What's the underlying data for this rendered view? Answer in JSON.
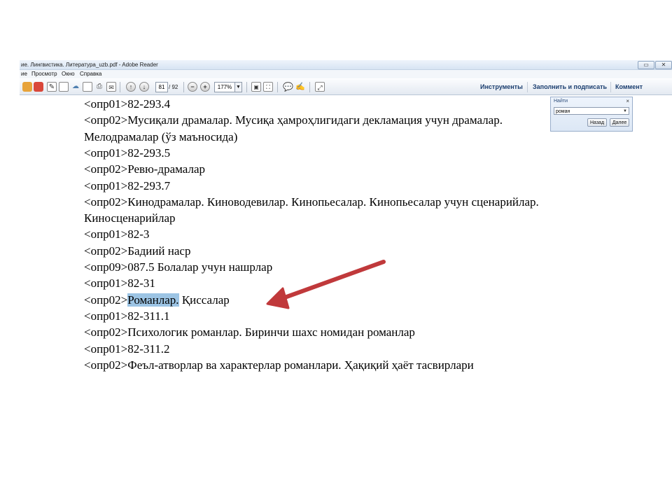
{
  "window": {
    "title": "ие. Лингвистика. Литература_uzb.pdf - Adobe Reader",
    "buttons": [
      "▭",
      "✕"
    ]
  },
  "menu": [
    "ие",
    "Просмотр",
    "Окно",
    "Справка"
  ],
  "toolbar": {
    "page_current": "81",
    "page_total": "/ 92",
    "zoom": "177%",
    "zoom_dropdown": "▼",
    "tools": "Инструменты",
    "fill_sign": "Заполнить и подписать",
    "comment": "Коммент"
  },
  "find": {
    "title": "Найти",
    "close": "×",
    "query": "роман",
    "dropdown": "▼",
    "prev": "Назад",
    "next": "Далее"
  },
  "document": {
    "lines": [
      "<опр01>82-293.4",
      "<опр02>Мусиқали драмалар. Мусиқа ҳамроҳлигидаги декламация учун драмалар.",
      "Мелодрамалар (ўз маъносида)",
      "<опр01>82-293.5",
      "<опр02>Ревю-драмалар",
      "<опр01>82-293.7",
      "<опр02>Кинодрамалар. Киноводевилар. Кинопьесалар. Кинопьесалар учун сценарийлар.",
      "Киносценарийлар",
      "<опр01>82-3",
      "<опр02>Бадиий наср",
      "<опр09>087.5 Болалар учун нашрлар",
      "<опр01>82-31"
    ],
    "hl_prefix": "<опр02>",
    "hl_word": "Романлар.",
    "hl_suffix": " Қиссалар",
    "lines_after": [
      "<опр01>82-311.1",
      "<опр02>Психологик романлар. Биринчи шахс номидан романлар",
      "<опр01>82-311.2",
      "<опр02>Феъл-атворлар ва характерлар романлари. Ҳақиқий ҳаёт тасвирлари"
    ]
  },
  "colors": {
    "highlight": "#9cc4e4",
    "arrow": "#c0393b"
  }
}
